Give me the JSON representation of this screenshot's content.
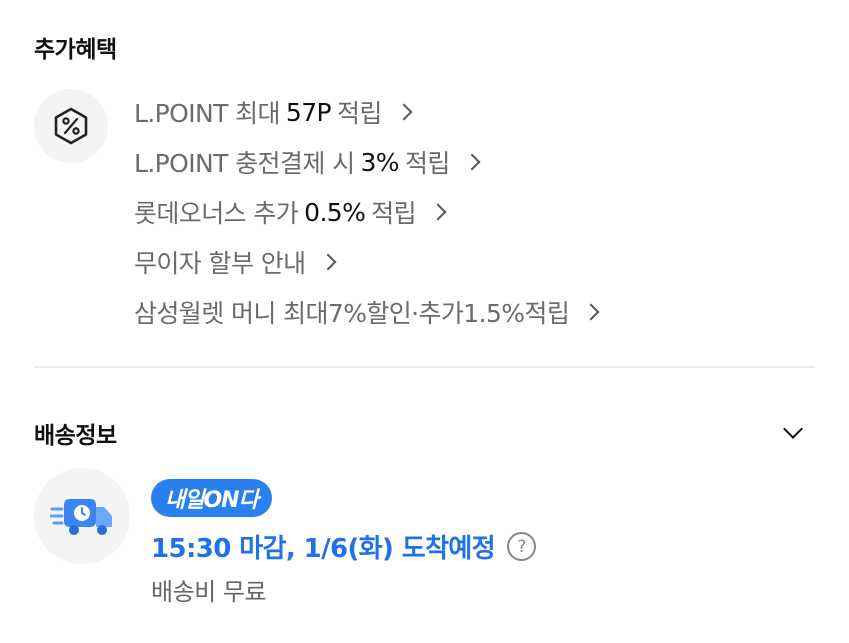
{
  "benefits": {
    "title": "추가혜택",
    "icon": "percent-hexagon-icon",
    "items": [
      {
        "before": "L.POINT 최대",
        "highlight": "57P",
        "after": "적립"
      },
      {
        "before": "L.POINT 충전결제 시",
        "highlight": "3%",
        "after": "적립"
      },
      {
        "before": "롯데오너스 추가",
        "highlight": "0.5%",
        "after": "적립"
      },
      {
        "before": "무이자 할부 안내",
        "highlight": "",
        "after": ""
      },
      {
        "before": "삼성월렛 머니 최대7%할인·추가1.5%적립",
        "highlight": "",
        "after": ""
      }
    ]
  },
  "shipping": {
    "title": "배송정보",
    "icon": "delivery-truck-clock-icon",
    "badge": "내일ON다",
    "delivery_text": "15:30 마감, 1/6(화) 도착예정",
    "help_symbol": "?",
    "fee": "배송비 무료",
    "accent_color": "#2a7ff1"
  }
}
